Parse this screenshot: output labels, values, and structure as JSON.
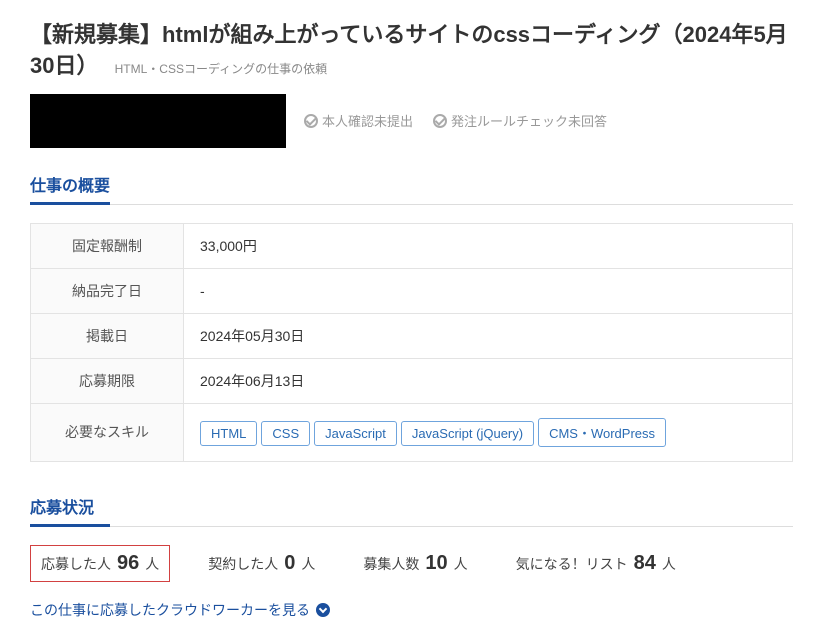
{
  "title": "【新規募集】htmlが組み上がっているサイトのcssコーディング（2024年5月30日）",
  "subtitle": "HTML・CSSコーディングの仕事の依頼",
  "statuses": {
    "identity": "本人確認未提出",
    "rulecheck": "発注ルールチェック未回答"
  },
  "sections": {
    "overview": "仕事の概要",
    "application": "応募状況"
  },
  "info": {
    "payment_type_label": "固定報酬制",
    "payment_value": "33,000円",
    "delivery_label": "納品完了日",
    "delivery_value": "-",
    "posted_label": "掲載日",
    "posted_value": "2024年05月30日",
    "deadline_label": "応募期限",
    "deadline_value": "2024年06月13日",
    "skills_label": "必要なスキル",
    "skills": [
      "HTML",
      "CSS",
      "JavaScript",
      "JavaScript (jQuery)",
      "CMS・WordPress"
    ]
  },
  "stats": {
    "applied_label": "応募した人",
    "applied_value": "96",
    "contracted_label": "契約した人",
    "contracted_value": "0",
    "slots_label": "募集人数",
    "slots_value": "10",
    "fav_label": "気になる！リスト",
    "fav_value": "84",
    "suffix": "人"
  },
  "link": "この仕事に応募したクラウドワーカーを見る"
}
